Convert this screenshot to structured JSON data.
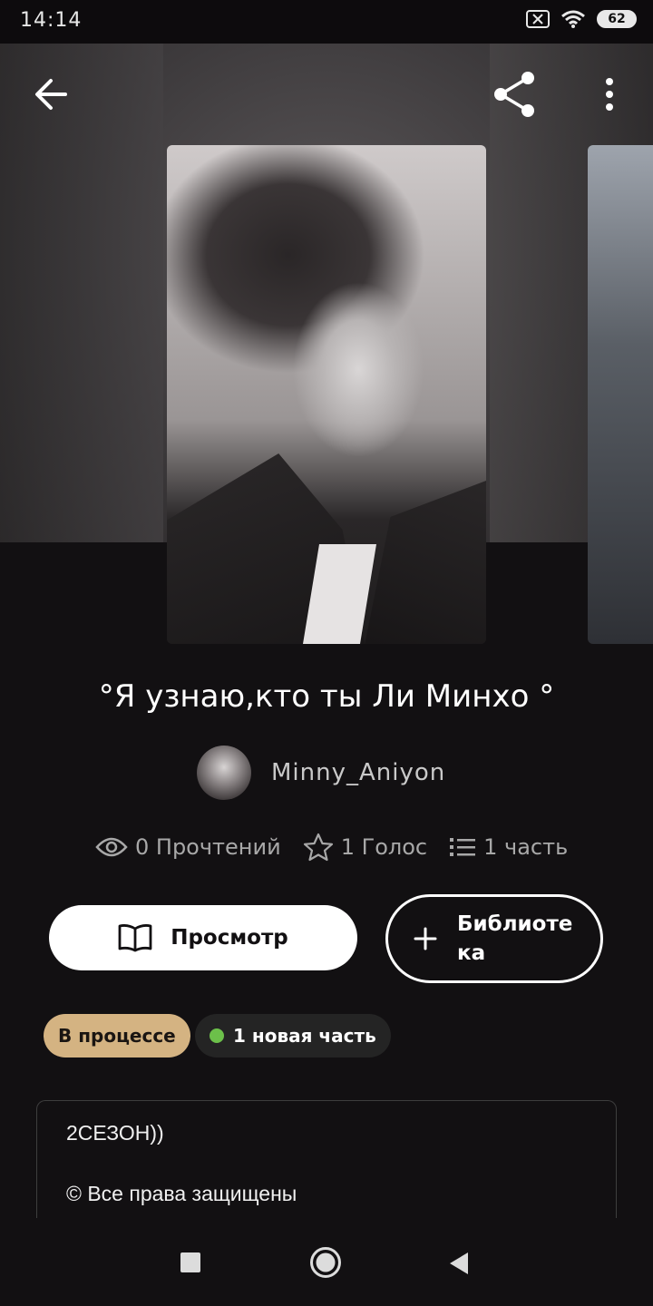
{
  "status_bar": {
    "time": "14:14",
    "battery": "62"
  },
  "header": {
    "back_icon": "arrow-left-icon",
    "share_icon": "share-icon",
    "menu_icon": "more-vertical-icon"
  },
  "story": {
    "title": "°Я узнаю,кто ты Ли Минхо °",
    "author": "Minny_Aniyon",
    "stats": {
      "reads": "0 Прочтений",
      "votes": "1 Голос",
      "parts": "1 часть"
    }
  },
  "actions": {
    "view_label": "Просмотр",
    "library_label": "Библиотека"
  },
  "badges": {
    "status": "В процессе",
    "new_parts": "1 новая часть"
  },
  "description": {
    "line1": "2СЕЗОН))",
    "line2": "© Все права защищены"
  },
  "colors": {
    "background": "#121012",
    "status_badge": "#d4b382",
    "new_dot": "#6cc04a"
  }
}
